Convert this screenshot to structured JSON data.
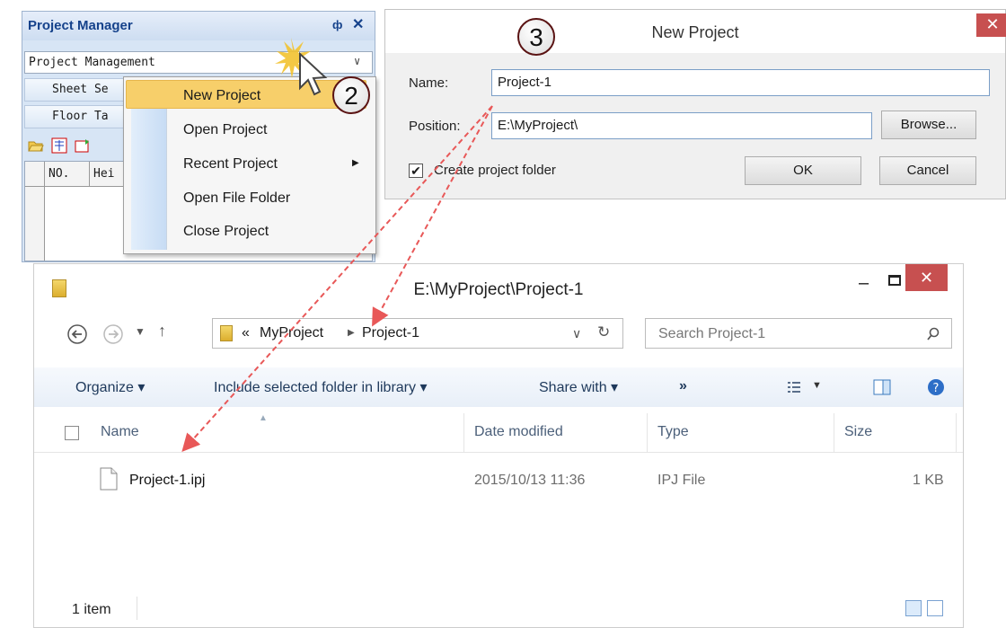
{
  "project_manager": {
    "title": "Project Manager",
    "pin_glyph": "ф",
    "close_glyph": "✕",
    "combo_value": "Project Management",
    "rows": [
      "Sheet Se",
      "Floor Ta"
    ],
    "grid_headers": [
      "NO.",
      "Hei"
    ]
  },
  "context_menu": {
    "items": [
      "New Project",
      "Open Project",
      "Recent Project",
      "Open File Folder",
      "Close Project"
    ]
  },
  "dialog": {
    "title": "New Project",
    "name_label": "Name:",
    "name_value": "Project-1",
    "position_label": "Position:",
    "position_value": "E:\\MyProject\\",
    "browse_label": "Browse...",
    "checkbox_label": "Create project folder",
    "checkbox_checked": true,
    "ok_label": "OK",
    "cancel_label": "Cancel"
  },
  "explorer": {
    "title": "E:\\MyProject\\Project-1",
    "breadcrumb_prefix": "«",
    "breadcrumb": [
      "MyProject",
      "Project-1"
    ],
    "search_placeholder": "Search Project-1",
    "toolbar": {
      "organize": "Organize ▾",
      "include": "Include selected folder in library ▾",
      "share": "Share with ▾",
      "more": "»"
    },
    "columns": [
      "Name",
      "Date modified",
      "Type",
      "Size"
    ],
    "rows": [
      {
        "name": "Project-1.ipj",
        "date": "2015/10/13 11:36",
        "type": "IPJ File",
        "size": "1 KB"
      }
    ],
    "status": "1 item"
  },
  "annotations": {
    "step_2": "2",
    "step_3": "3",
    "arrow_color": "#e85858"
  },
  "colors": {
    "menu_highlight": "#f7cf6a",
    "close_red": "#c75050",
    "panel_blue": "#d7e5f5"
  }
}
